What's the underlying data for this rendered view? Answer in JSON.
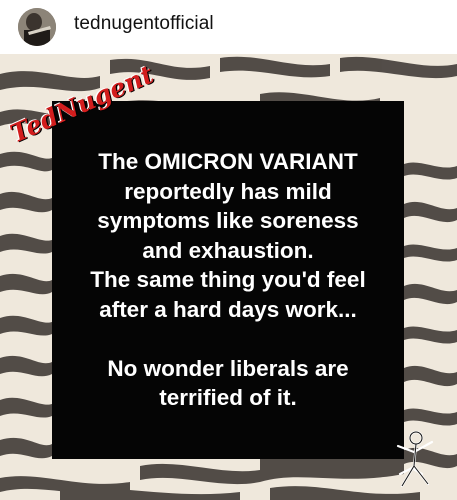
{
  "header": {
    "username": "tednugentofficial"
  },
  "post": {
    "logo_text": "TedNugent",
    "caption_lines": [
      "The OMICRON VARIANT",
      "reportedly has mild",
      "symptoms like soreness",
      "and exhaustion.",
      "The same thing you'd feel",
      "after a hard days work...",
      "",
      "No wonder liberals are",
      "terrified of it."
    ],
    "colors": {
      "background_box": "#050505",
      "text": "#ffffff",
      "logo": "#d21d1d",
      "zebra_light": "#efe8dc",
      "zebra_dark": "#4a4440"
    }
  }
}
